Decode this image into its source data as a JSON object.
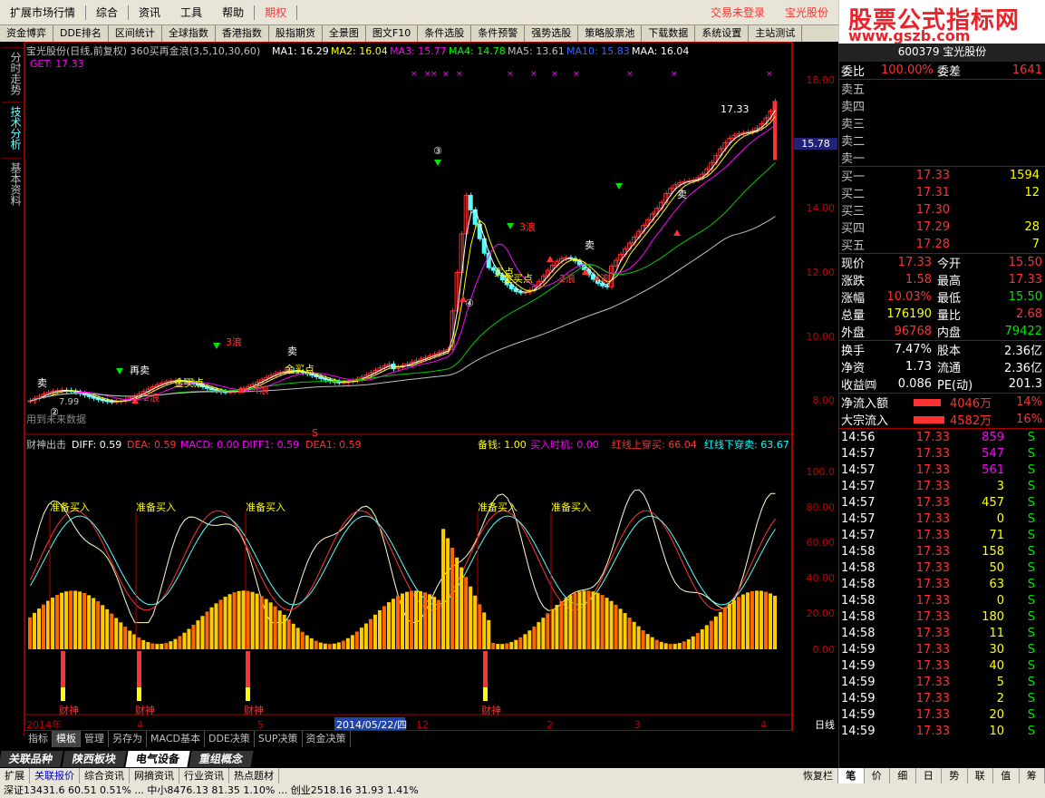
{
  "menu": {
    "items": [
      "扩展市场行情",
      "综合",
      "资讯",
      "工具",
      "帮助",
      "期权"
    ],
    "trade_login": "交易未登录",
    "stock_name": "宝光股份"
  },
  "brand": {
    "title": "股票公式指标网",
    "url": "www.gszb.com"
  },
  "toolbar": [
    "资金博弈",
    "DDE排名",
    "区间统计",
    "全球指数",
    "香港指数",
    "股指期货",
    "全景图",
    "图文F10",
    "条件选股",
    "条件预警",
    "强势选股",
    "策略股票池",
    "下载数据",
    "系统设置",
    "主站测试"
  ],
  "vtabs": [
    "分时走势",
    "技术分析",
    "基本资料"
  ],
  "price_info": {
    "title": "宝光股份(日线,前复权) 360买再金浪(3,5,10,30,60)",
    "ma1": "MA1: 16.29",
    "ma2": "MA2: 16.04",
    "ma3": "MA3: 15.77",
    "ma4": "MA4: 14.78",
    "ma5": "MA5: 13.61",
    "ma10": "MA10: 15.83",
    "maa": "MAA: 16.04",
    "get": "GET: 17.33",
    "future_note": "用到未来数据",
    "last_price_label": "17.33",
    "low_label": "7.99",
    "current_price_marker": "15.78"
  },
  "price_axis": [
    "18.00",
    "16.00",
    "14.00",
    "12.00",
    "10.00",
    "8.00"
  ],
  "annotations": {
    "sell": "卖",
    "again_sell": "再卖",
    "gold_buy": "金买点",
    "buy_point": "买点",
    "w2": "2浪",
    "w3": "3浪",
    "w4": "4浪",
    "r2": "2浪",
    "r4": "4浪",
    "n3": "③",
    "n4": "④",
    "n2": "②",
    "s": "S"
  },
  "indicator_info": {
    "name": "财神出击",
    "diff": "DIFF: 0.59",
    "dea": "DEA: 0.59",
    "macd": "MACD: 0.00",
    "diff1": "DIFF1: 0.59",
    "dea1": "DEA1: 0.59",
    "beiqian": "备钱: 1.00",
    "buytime": "买入时机: 0.00",
    "red_up": "红线上穿买: 66.04",
    "red_down": "红线下穿卖: 63.67",
    "ready_buy": "准备买入",
    "caishen": "财神"
  },
  "ind_axis": [
    "100.0",
    "80.00",
    "60.00",
    "40.00",
    "20.00",
    "0.00"
  ],
  "date_axis": {
    "year": "2014年",
    "m1": "4",
    "m2": "5",
    "cursor_date": "2014/05/22/四",
    "m3": "12",
    "m4": "2",
    "m5": "3",
    "m6": "4",
    "period": "日线"
  },
  "bottom_tabs1": [
    "指标",
    "模板",
    "管理",
    "另存为",
    "MACD基本",
    "DDE决策",
    "SUP决策",
    "资金决策"
  ],
  "bottom_tabs2": [
    "关联品种",
    "陕西板块",
    "电气设备",
    "重组概念"
  ],
  "bottom_tabs3": [
    "扩展",
    "关联报价",
    "综合资讯",
    "网摘资讯",
    "行业资讯",
    "热点题材",
    "恢复栏"
  ],
  "status_text": "深证13431.6  60.51  0.51%  ...  中小8476.13  81.35  1.10%  ...  创业2518.16  31.93  1.41%",
  "quote": {
    "code": "600379 宝光股份",
    "webi": "委比",
    "webi_val": "100.00%",
    "wecha": "委差",
    "wecha_val": "1641",
    "sells": [
      {
        "label": "卖五",
        "price": "",
        "vol": ""
      },
      {
        "label": "卖四",
        "price": "",
        "vol": ""
      },
      {
        "label": "卖三",
        "price": "",
        "vol": ""
      },
      {
        "label": "卖二",
        "price": "",
        "vol": ""
      },
      {
        "label": "卖一",
        "price": "",
        "vol": ""
      }
    ],
    "buys": [
      {
        "label": "买一",
        "price": "17.33",
        "vol": "1594"
      },
      {
        "label": "买二",
        "price": "17.31",
        "vol": "12"
      },
      {
        "label": "买三",
        "price": "17.30",
        "vol": ""
      },
      {
        "label": "买四",
        "price": "17.29",
        "vol": "28"
      },
      {
        "label": "买五",
        "price": "17.28",
        "vol": "7"
      }
    ],
    "stats": [
      [
        "现价",
        "17.33",
        "今开",
        "15.50"
      ],
      [
        "涨跌",
        "1.58",
        "最高",
        "17.33"
      ],
      [
        "涨幅",
        "10.03%",
        "最低",
        "15.50"
      ],
      [
        "总量",
        "176190",
        "量比",
        "2.68"
      ],
      [
        "外盘",
        "96768",
        "内盘",
        "79422"
      ]
    ],
    "stats2": [
      [
        "换手",
        "7.47%",
        "股本",
        "2.36亿"
      ],
      [
        "净资",
        "1.73",
        "流通",
        "2.36亿"
      ],
      [
        "收益㈣",
        "0.086",
        "PE(动)",
        "201.3"
      ]
    ],
    "netflow": {
      "label": "净流入额",
      "val": "4046万",
      "pct": "14%",
      "fill": 0.75
    },
    "bigflow": {
      "label": "大宗流入",
      "val": "4582万",
      "pct": "16%",
      "fill": 0.85
    },
    "ticks": [
      [
        "14:56",
        "17.33",
        "859",
        "S"
      ],
      [
        "14:57",
        "17.33",
        "547",
        "S"
      ],
      [
        "14:57",
        "17.33",
        "561",
        "S"
      ],
      [
        "14:57",
        "17.33",
        "3",
        "S"
      ],
      [
        "14:57",
        "17.33",
        "457",
        "S"
      ],
      [
        "14:57",
        "17.33",
        "0",
        "S"
      ],
      [
        "14:57",
        "17.33",
        "71",
        "S"
      ],
      [
        "14:58",
        "17.33",
        "158",
        "S"
      ],
      [
        "14:58",
        "17.33",
        "50",
        "S"
      ],
      [
        "14:58",
        "17.33",
        "63",
        "S"
      ],
      [
        "14:58",
        "17.33",
        "0",
        "S"
      ],
      [
        "14:58",
        "17.33",
        "180",
        "S"
      ],
      [
        "14:58",
        "17.33",
        "11",
        "S"
      ],
      [
        "14:59",
        "17.33",
        "30",
        "S"
      ],
      [
        "14:59",
        "17.33",
        "40",
        "S"
      ],
      [
        "14:59",
        "17.33",
        "5",
        "S"
      ],
      [
        "14:59",
        "17.33",
        "2",
        "S"
      ],
      [
        "14:59",
        "17.33",
        "20",
        "S"
      ],
      [
        "14:59",
        "17.33",
        "10",
        "S"
      ]
    ],
    "tabs": [
      "笔",
      "价",
      "细",
      "日",
      "势",
      "联",
      "值",
      "筹"
    ]
  }
}
